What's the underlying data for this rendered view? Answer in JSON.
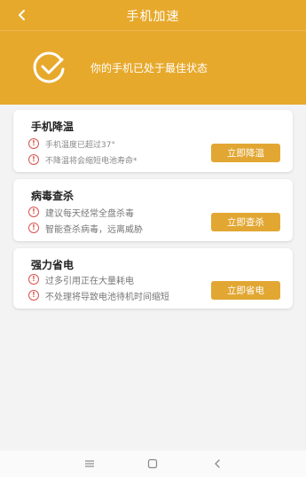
{
  "header": {
    "title": "手机加速",
    "status_text": "你的手机已处于最佳状态",
    "background": "#e7a92c"
  },
  "cards": [
    {
      "title": "手机降温",
      "lines": [
        "手机温度已超过37°",
        "不降温将会缩短电池寿命*"
      ],
      "button_label": "立即降温"
    },
    {
      "title": "病毒查杀",
      "lines": [
        "建议每天经常全盘杀毒",
        "智能查杀病毒，远离威胁"
      ],
      "button_label": "立即查杀"
    },
    {
      "title": "强力省电",
      "lines": [
        "过多引用正在大量耗电",
        "不处理将导致电池待机时间缩短"
      ],
      "button_label": "立即省电"
    }
  ],
  "icons": {
    "back": "chevron-left-icon",
    "status": "check-circle-icon",
    "alert": "alert-circle-icon",
    "nav_menu": "menu-icon",
    "nav_home": "square-icon",
    "nav_back": "triangle-back-icon"
  },
  "colors": {
    "accent": "#e2a733",
    "alert": "#d9534f"
  }
}
